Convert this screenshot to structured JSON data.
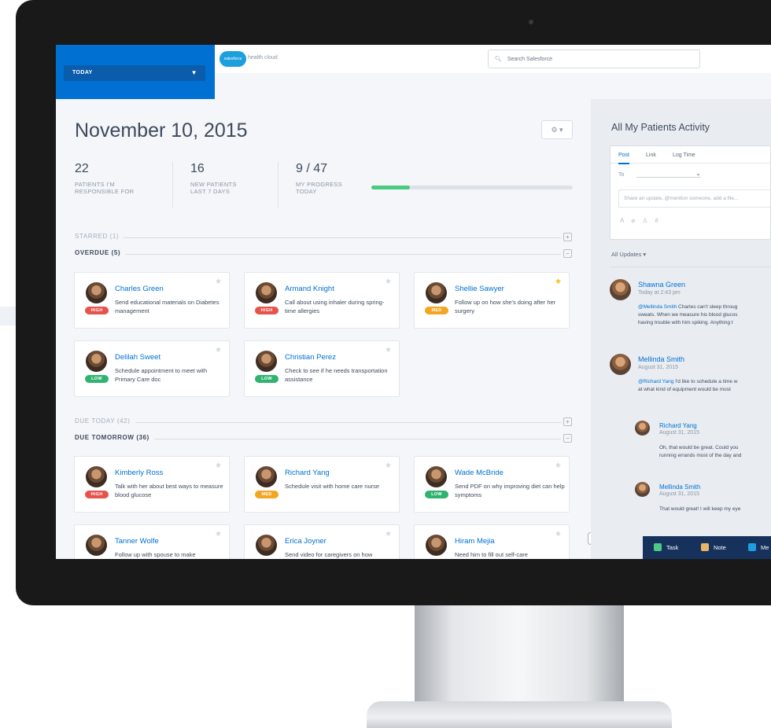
{
  "header": {
    "view_select": "TODAY",
    "logo_text": "salesforce",
    "logo_sub": "health cloud",
    "search_placeholder": "Search Salesforce"
  },
  "main": {
    "date": "November 10, 2015",
    "stats": [
      {
        "value": "22",
        "label_line1": "PATIENTS I'M",
        "label_line2": "RESPONSIBLE FOR"
      },
      {
        "value": "16",
        "label_line1": "NEW PATIENTS",
        "label_line2": "LAST 7 DAYS"
      },
      {
        "value": "9 / 47",
        "label_line1": "MY PROGRESS",
        "label_line2": "TODAY"
      }
    ],
    "progress_fraction": 0.19,
    "sections": {
      "starred": "STARRED (1)",
      "overdue": "OVERDUE (5)",
      "due_today": "DUE TODAY (42)",
      "due_tomorrow": "DUE TOMORROW (36)"
    },
    "overdue_cards": [
      {
        "name": "Charles Green",
        "desc": "Send educational materials on Diabetes management",
        "priority": "HIGH",
        "starred": false
      },
      {
        "name": "Armand Knight",
        "desc": "Call about using inhaler during spring-time allergies",
        "priority": "HIGH",
        "starred": false
      },
      {
        "name": "Shellie Sawyer",
        "desc": "Follow up on how she's doing after her surgery",
        "priority": "MED",
        "starred": true
      },
      {
        "name": "Delilah Sweet",
        "desc": "Schedule appointment to meet with Primary Care doc",
        "priority": "LOW",
        "starred": false
      },
      {
        "name": "Christian Perez",
        "desc": "Check to see if he needs transportation assistance",
        "priority": "LOW",
        "starred": false
      }
    ],
    "tomorrow_cards": [
      {
        "name": "Kimberly Ross",
        "desc": "Talk with her about best ways to measure blood glucose",
        "priority": "HIGH",
        "starred": false
      },
      {
        "name": "Richard Yang",
        "desc": "Schedule visit with home care nurse",
        "priority": "MED",
        "starred": false
      },
      {
        "name": "Wade McBride",
        "desc": "Send PDF on why improving diet can help symptoms",
        "priority": "LOW",
        "starred": false
      },
      {
        "name": "Tanner Wolfe",
        "desc": "Follow up with spouse to make",
        "priority": "",
        "starred": false
      },
      {
        "name": "Erica Joyner",
        "desc": "Send video for caregivers on how",
        "priority": "",
        "starred": false
      },
      {
        "name": "Hiram Mejia",
        "desc": "Need him to fill out self-care",
        "priority": "",
        "starred": false
      }
    ]
  },
  "side": {
    "title": "All My Patients Activity",
    "tabs": [
      "Post",
      "Link",
      "Log Time"
    ],
    "to_label": "To",
    "share_placeholder": "Share an update, @mention someone, add a file...",
    "updates_filter": "All Updates ▾",
    "feed": [
      {
        "name": "Shawna Green",
        "date": "Today at 2:43 pm",
        "mention": "@Mellinda Smith",
        "line1": " Charles can't sleep throug",
        "line2": "sweats. When we measure his blood glucos",
        "line3": "having trouble with him spiking. Anything t"
      },
      {
        "name": "Mellinda Smith",
        "date": "August 31, 2015",
        "mention": "@Richard Yang",
        "line1": " I'd like to schedule a time w",
        "line2": "at what kind of equipment would be most"
      },
      {
        "name": "Richard Yang",
        "date": "August 31, 2015",
        "line1": "Oh, that would be great. Could you",
        "line2": "running errands most of the day and"
      },
      {
        "name": "Mellinda Smith",
        "date": "August 31, 2015",
        "line1": "That would great!  I will keep my eye"
      }
    ]
  },
  "actions": {
    "task": "Task",
    "note": "Note",
    "third": "Me"
  },
  "colors": {
    "brand_blue": "#0070d2",
    "nav_blue": "#16325c",
    "high": "#e5534b",
    "med": "#f4a623",
    "low": "#2fb36f",
    "progress": "#4bca81"
  }
}
